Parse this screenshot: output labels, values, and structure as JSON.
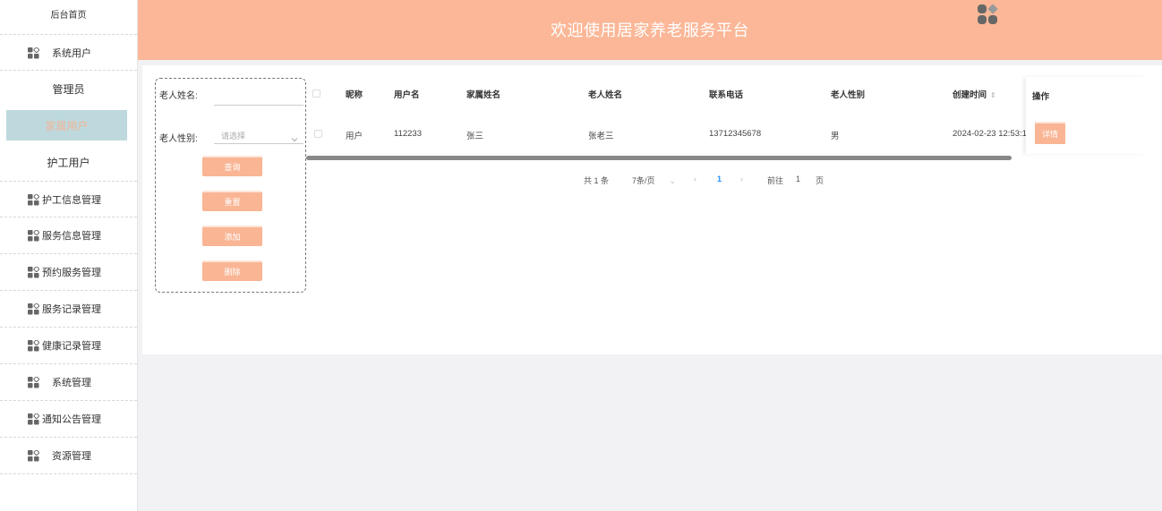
{
  "sidebar": {
    "home_label": "后台首页",
    "system_users": "系统用户",
    "sub_items": [
      "管理员",
      "家属用户",
      "护工用户"
    ],
    "active_sub": 1,
    "menu": [
      {
        "label": "护工信息管理",
        "icon": "grid-icon"
      },
      {
        "label": "服务信息管理",
        "icon": "grid-icon"
      },
      {
        "label": "预约服务管理",
        "icon": "grid-icon"
      },
      {
        "label": "服务记录管理",
        "icon": "grid-icon"
      },
      {
        "label": "健康记录管理",
        "icon": "grid-icon"
      },
      {
        "label": "系统管理",
        "icon": "grid-icon"
      },
      {
        "label": "通知公告管理",
        "icon": "grid-icon"
      },
      {
        "label": "资源管理",
        "icon": "grid-icon"
      }
    ]
  },
  "header": {
    "title": "欢迎使用居家养老服务平台",
    "bg_color": "#fbb797"
  },
  "search": {
    "elder_name_label": "老人姓名:",
    "elder_name_value": "",
    "elder_gender_label": "老人性别:",
    "elder_gender_placeholder": "请选择",
    "query_btn": "查询",
    "reset_btn": "重置",
    "add_btn": "添加",
    "delete_btn": "删除"
  },
  "table": {
    "columns": [
      "昵称",
      "用户名",
      "家属姓名",
      "老人姓名",
      "联系电话",
      "老人性别",
      "创建时间",
      "操作"
    ],
    "rows": [
      {
        "nickname": "用户",
        "username": "112233",
        "family_name": "张三",
        "elder_name": "张老三",
        "phone": "13712345678",
        "gender": "男",
        "created": "2024-02-23 12:53:1",
        "action": "详情"
      }
    ]
  },
  "pager": {
    "total": "共 1 条",
    "page_size": "7条/页",
    "current": "1",
    "goto_label": "前往",
    "goto_value": "1",
    "page_unit": "页"
  },
  "accent_color": "#f9b594"
}
